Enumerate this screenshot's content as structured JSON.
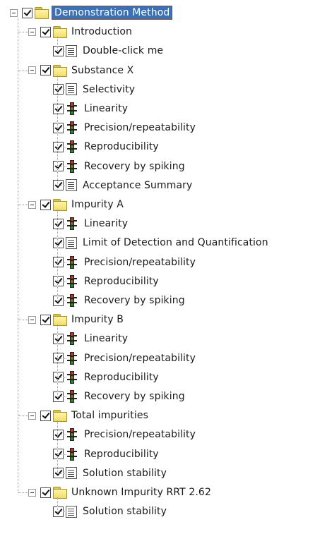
{
  "tree": {
    "root": {
      "label": "Demonstration Method",
      "selected": true
    },
    "groups": [
      {
        "label": "Introduction",
        "children": [
          {
            "label": "Double-click me",
            "icon": "document-icon"
          }
        ]
      },
      {
        "label": "Substance X",
        "children": [
          {
            "label": "Selectivity",
            "icon": "document-icon"
          },
          {
            "label": "Linearity",
            "icon": "traffic-light-icon"
          },
          {
            "label": "Precision/repeatability",
            "icon": "traffic-light-icon"
          },
          {
            "label": "Reproducibility",
            "icon": "traffic-light-icon"
          },
          {
            "label": "Recovery by spiking",
            "icon": "traffic-light-icon"
          },
          {
            "label": "Acceptance Summary",
            "icon": "document-icon"
          }
        ]
      },
      {
        "label": "Impurity A",
        "children": [
          {
            "label": "Linearity",
            "icon": "traffic-light-icon"
          },
          {
            "label": "Limit of Detection and Quantification",
            "icon": "document-icon"
          },
          {
            "label": "Precision/repeatability",
            "icon": "traffic-light-icon"
          },
          {
            "label": "Reproducibility",
            "icon": "traffic-light-icon"
          },
          {
            "label": "Recovery by spiking",
            "icon": "traffic-light-icon"
          }
        ]
      },
      {
        "label": "Impurity B",
        "children": [
          {
            "label": "Linearity",
            "icon": "traffic-light-icon"
          },
          {
            "label": "Precision/repeatability",
            "icon": "traffic-light-icon"
          },
          {
            "label": "Reproducibility",
            "icon": "traffic-light-icon"
          },
          {
            "label": "Recovery by spiking",
            "icon": "traffic-light-icon"
          }
        ]
      },
      {
        "label": "Total impurities",
        "children": [
          {
            "label": "Precision/repeatability",
            "icon": "traffic-light-icon"
          },
          {
            "label": "Reproducibility",
            "icon": "traffic-light-icon"
          },
          {
            "label": "Solution stability",
            "icon": "document-icon"
          }
        ]
      },
      {
        "label": "Unknown Impurity RRT 2.62",
        "children": [
          {
            "label": "Solution stability",
            "icon": "document-icon"
          }
        ]
      }
    ]
  },
  "colors": {
    "selection": "#3a72b5",
    "selection_border": "#8b4a2b",
    "folder": "#f1dc6c",
    "tree_line": "#9a9a9a"
  }
}
